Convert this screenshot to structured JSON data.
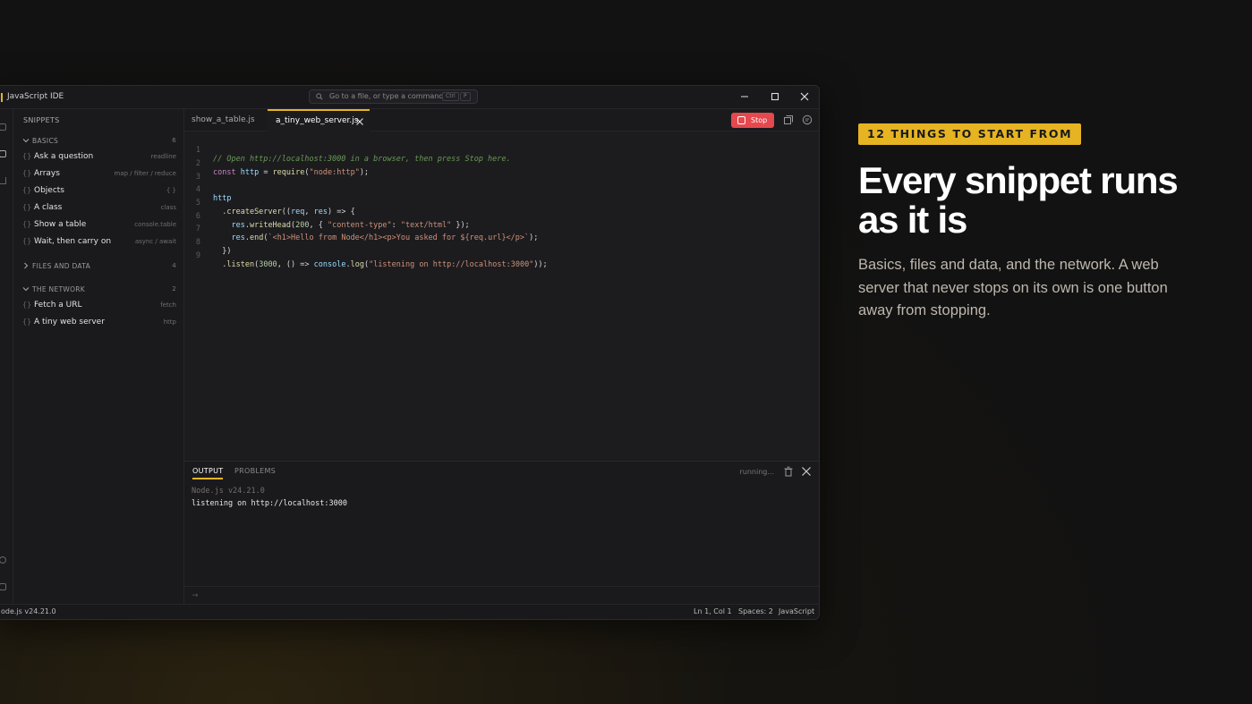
{
  "window": {
    "title": "JavaScript IDE",
    "command_palette": {
      "placeholder": "Go to a file, or type a command",
      "key1": "Ctrl",
      "key2": "P"
    }
  },
  "sidebar": {
    "header": "SNIPPETS",
    "groups": [
      {
        "label": "BASICS",
        "count": "6",
        "expanded": true,
        "items": [
          {
            "label": "Ask a question",
            "tag": "readline"
          },
          {
            "label": "Arrays",
            "tag": "map / filter / reduce"
          },
          {
            "label": "Objects",
            "tag": "{ }"
          },
          {
            "label": "A class",
            "tag": "class"
          },
          {
            "label": "Show a table",
            "tag": "console.table"
          },
          {
            "label": "Wait, then carry on",
            "tag": "async / await"
          }
        ]
      },
      {
        "label": "FILES AND DATA",
        "count": "4",
        "expanded": false,
        "items": []
      },
      {
        "label": "THE NETWORK",
        "count": "2",
        "expanded": true,
        "items": [
          {
            "label": "Fetch a URL",
            "tag": "fetch"
          },
          {
            "label": "A tiny web server",
            "tag": "http"
          }
        ]
      }
    ],
    "item_bracket": "{}"
  },
  "tabs": [
    {
      "label": "show_a_table.js",
      "active": false
    },
    {
      "label": "a_tiny_web_server.js",
      "active": true
    }
  ],
  "toolbar": {
    "stop_label": "Stop"
  },
  "editor": {
    "lines": [
      {
        "n": "1",
        "t1": "// Open http://localhost:3000 in a browser, then press Stop here."
      },
      {
        "n": "2",
        "t1": "const",
        "t2": " ",
        "t3": "http",
        "t4": " = ",
        "t5": "require",
        "t6": "(",
        "t7": "\"node:http\"",
        "t8": ");"
      },
      {
        "n": "3"
      },
      {
        "n": "4",
        "t1": "http"
      },
      {
        "n": "5",
        "t1": "  .",
        "t2": "createServer",
        "t3": "((",
        "t4": "req",
        "t5": ", ",
        "t6": "res",
        "t7": ") => {"
      },
      {
        "n": "6",
        "t1": "    ",
        "t2": "res",
        "t3": ".",
        "t4": "writeHead",
        "t5": "(",
        "t6": "200",
        "t7": ", { ",
        "t8": "\"content-type\"",
        "t9": ": ",
        "t10": "\"text/html\"",
        "t11": " });"
      },
      {
        "n": "7",
        "t1": "    ",
        "t2": "res",
        "t3": ".",
        "t4": "end",
        "t5": "(",
        "t6": "`<h1>Hello from Node</h1><p>You asked for ${req.url}</p>`",
        "t7": ");"
      },
      {
        "n": "8",
        "t1": "  })"
      },
      {
        "n": "9",
        "t1": "  .",
        "t2": "listen",
        "t3": "(",
        "t4": "3000",
        "t5": ", () => ",
        "t6": "console",
        "t7": ".",
        "t8": "log",
        "t9": "(",
        "t10": "\"listening on http://localhost:3000\"",
        "t11": "));"
      }
    ]
  },
  "panel": {
    "tabs": [
      "OUTPUT",
      "PROBLEMS"
    ],
    "status": "running...",
    "output": [
      "Node.js v24.21.0",
      "listening on http://localhost:3000"
    ],
    "prompt": "→"
  },
  "statusbar": {
    "left": "ode.js v24.21.0",
    "position": "Ln 1, Col 1",
    "spaces": "Spaces: 2",
    "language": "JavaScript"
  },
  "promo": {
    "badge": "12 THINGS TO START FROM",
    "headline": "Every snippet runs as it is",
    "body": "Basics, files and data, and the network. A web server that never stops on its own is one button away from stopping."
  },
  "colors": {
    "accent": "#e6b422",
    "stop": "#e5484d",
    "background": "#131313"
  }
}
